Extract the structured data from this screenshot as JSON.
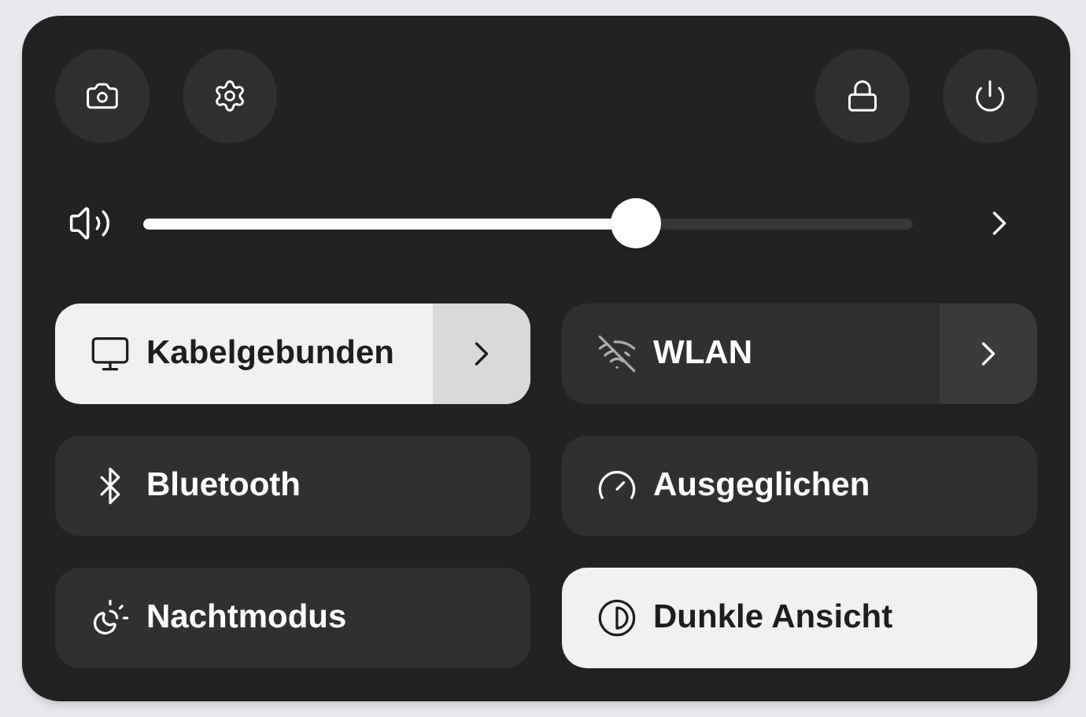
{
  "volume": {
    "level": 0.64
  },
  "toggles": [
    {
      "label": "Kabelgebunden",
      "on": true,
      "menu": true
    },
    {
      "label": "WLAN",
      "on": false,
      "menu": true
    },
    {
      "label": "Bluetooth",
      "on": false,
      "menu": false
    },
    {
      "label": "Ausgeglichen",
      "on": false,
      "menu": false
    },
    {
      "label": "Nachtmodus",
      "on": false,
      "menu": false
    },
    {
      "label": "Dunkle Ansicht",
      "on": true,
      "menu": false
    }
  ]
}
